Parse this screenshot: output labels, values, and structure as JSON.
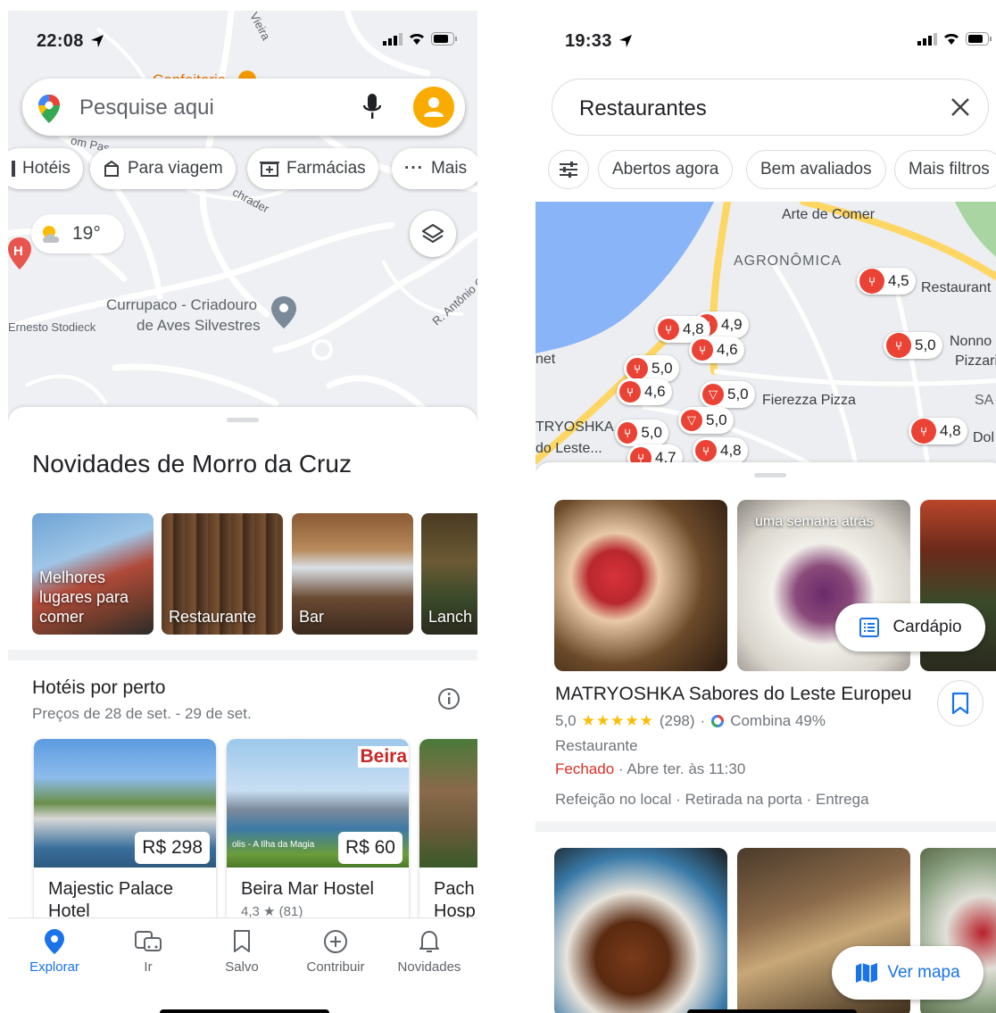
{
  "left_screen": {
    "status": {
      "time": "22:08"
    },
    "search": {
      "placeholder": "Pesquise aqui"
    },
    "chips": [
      {
        "label": "Hotéis",
        "icon": "bed-icon"
      },
      {
        "label": "Para viagem",
        "icon": "takeout-bag-icon"
      },
      {
        "label": "Farmácias",
        "icon": "pharmacy-icon"
      },
      {
        "label": "Mais",
        "icon": "more-dots-icon"
      }
    ],
    "map": {
      "weather": "19°",
      "labels": {
        "poi_top": "Confeitaria",
        "poi_line1": "Currupaco - Criadouro",
        "poi_line2": "de Aves Silvestres",
        "street_left": "Ernesto Stodieck",
        "street_right": "R. Antônio C",
        "street_top": "o Vieira",
        "street_mid": "chrader",
        "street_pass": "om Pas"
      }
    },
    "sheet": {
      "title": "Novidades de Morro da Cruz",
      "categories": [
        {
          "label": "Melhores lugares para comer"
        },
        {
          "label": "Restaurante"
        },
        {
          "label": "Bar"
        },
        {
          "label": "Lanch"
        }
      ],
      "hotels_title": "Hotéis por perto",
      "hotels_subtitle": "Preços de 28 de set. - 29 de set.",
      "hotels": [
        {
          "name": "Majestic Palace Hotel",
          "price": "R$ 298",
          "rating": ""
        },
        {
          "name": "Beira Mar Hostel",
          "price": "R$ 60",
          "rating": "4,3 ★ (81)",
          "sign": "Beira",
          "caption": "olis - A Ilha da Magia"
        },
        {
          "name": "Pach Hosp",
          "price": "",
          "rating": ""
        }
      ]
    },
    "nav": [
      {
        "label": "Explorar",
        "icon": "explore-pin-icon",
        "active": true
      },
      {
        "label": "Ir",
        "icon": "commute-icon",
        "active": false
      },
      {
        "label": "Salvo",
        "icon": "bookmark-icon",
        "active": false
      },
      {
        "label": "Contribuir",
        "icon": "add-circle-icon",
        "active": false
      },
      {
        "label": "Novidades",
        "icon": "bell-icon",
        "active": false
      }
    ]
  },
  "right_screen": {
    "status": {
      "time": "19:33"
    },
    "search": {
      "query": "Restaurantes"
    },
    "filters": [
      {
        "label": "Abertos agora"
      },
      {
        "label": "Bem avaliados"
      },
      {
        "label": "Mais filtros"
      }
    ],
    "map": {
      "labels": {
        "neighborhood": "AGRONÔMICA",
        "arte": "Arte de Comer",
        "restaurant_right": "Restaurant",
        "nonno1": "Nonno",
        "nonno2": "Pizzari",
        "fierezza": "Fierezza Pizza",
        "sa": "SA",
        "matryoshka": "TRYOSHKA",
        "leste": "do Leste...",
        "net": "net",
        "dol": "Dol"
      },
      "pins": [
        "4,9",
        "4,8",
        "4,6",
        "5,0",
        "4,6",
        "5,0",
        "5,0",
        "5,0",
        "4,7",
        "4,8",
        "4,5",
        "5,0",
        "4,8"
      ]
    },
    "result": {
      "photo_badge": "uma semana atrás",
      "menu_label": "Cardápio",
      "name": "MATRYOSHKA Sabores do Leste Europeu",
      "rating": "5,0",
      "stars": "★★★★★",
      "reviews": "(298)",
      "match": "Combina 49%",
      "type": "Restaurante",
      "status_closed": "Fechado",
      "status_opens": "· Abre ter. às 11:30",
      "services": "Refeição no local · Retirada na porta · Entrega"
    },
    "view_map": "Ver mapa"
  },
  "colors": {
    "accent_blue": "#1a73e8",
    "pin_red": "#ea4335",
    "avatar_yellow": "#f9ab00",
    "star_yellow": "#fbbc04",
    "closed_red": "#d93025"
  }
}
